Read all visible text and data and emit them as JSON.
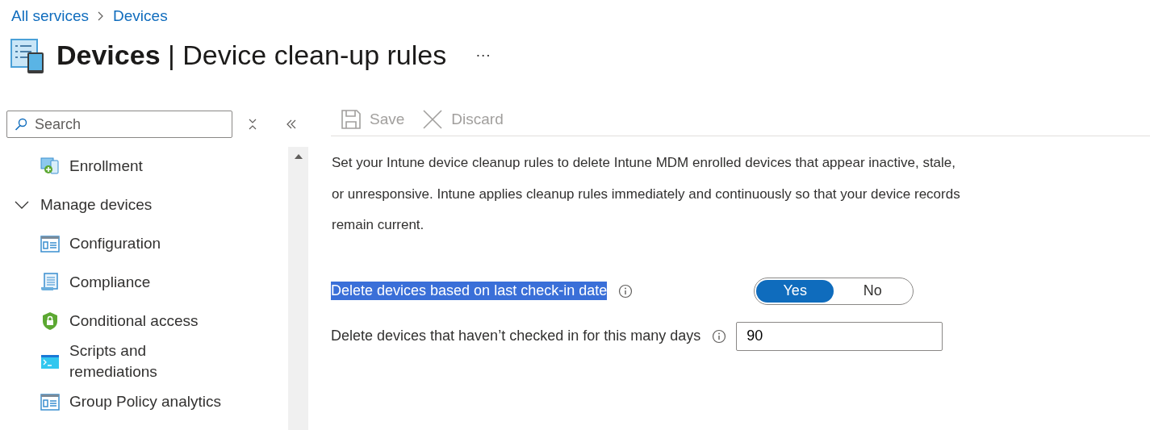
{
  "breadcrumb": [
    "All services",
    "Devices"
  ],
  "header": {
    "title_bold": "Devices",
    "title_rest": "| Device clean-up rules",
    "more": "···"
  },
  "sidebar": {
    "search": {
      "placeholder": "Search"
    },
    "items": [
      {
        "label": "Enrollment",
        "kind": "enroll"
      },
      {
        "label": "Manage devices",
        "expanded": true,
        "children": [
          {
            "label": "Configuration",
            "kind": "config"
          },
          {
            "label": "Compliance",
            "kind": "compliance"
          },
          {
            "label": "Conditional access",
            "kind": "shield"
          },
          {
            "label": "Scripts and remediations",
            "kind": "terminal"
          },
          {
            "label": "Group Policy analytics",
            "kind": "config"
          }
        ]
      }
    ]
  },
  "toolbar": [
    {
      "label": "Save",
      "kind": "save",
      "disabled": true
    },
    {
      "label": "Discard",
      "kind": "discard",
      "disabled": true
    }
  ],
  "description": "Set your Intune device cleanup rules to delete Intune MDM enrolled devices that appear inactive, stale, or unresponsive. Intune applies cleanup rules immediately and continuously so that your device records remain current.",
  "settings": [
    {
      "kind": "toggle",
      "label": "Delete devices based on last check-in date",
      "text_selected": true,
      "options": [
        {
          "label": "Yes",
          "selected": true
        },
        {
          "label": "No",
          "selected": false
        }
      ]
    },
    {
      "kind": "input",
      "label": "Delete devices that haven’t checked in for this many days",
      "text_selected": false,
      "value": "90"
    }
  ]
}
